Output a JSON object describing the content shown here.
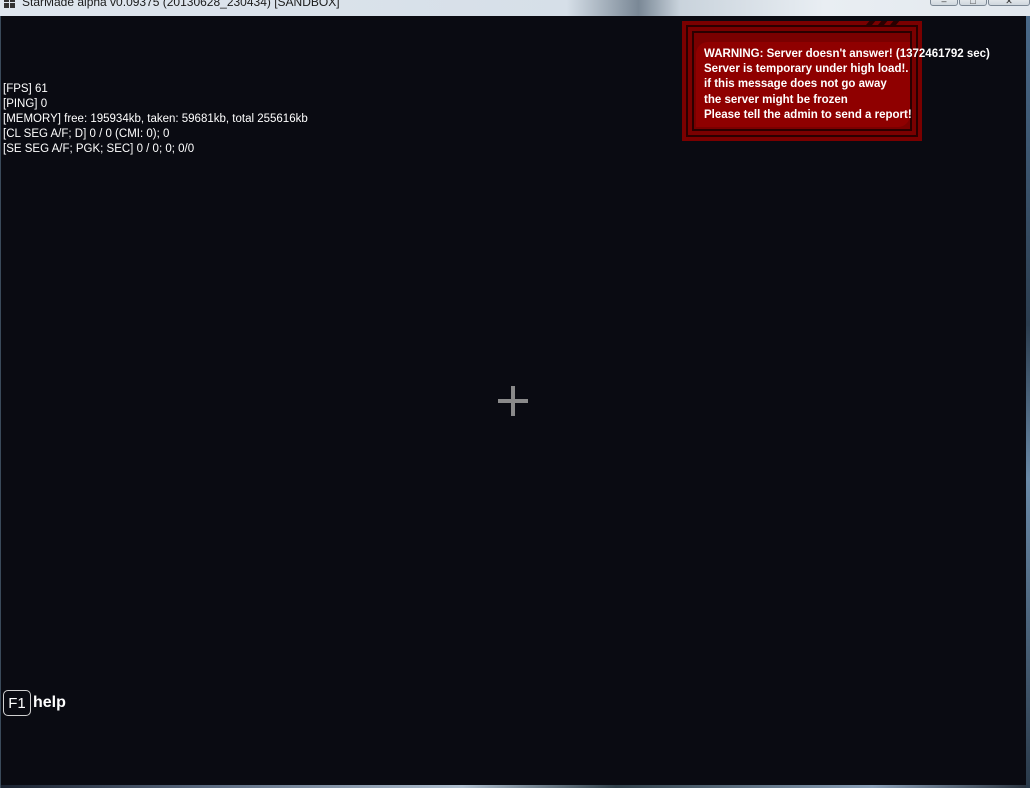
{
  "window": {
    "title": "StarMade alpha v0.09375 (20130628_230434) [SANDBOX]",
    "controls": {
      "minimize": "–",
      "maximize": "□",
      "close": "✕"
    }
  },
  "hud": {
    "lines": [
      "[FPS] 61",
      "[PING] 0",
      "[MEMORY] free: 195934kb, taken: 59681kb, total 255616kb",
      "[CL SEG A/F; D] 0 / 0 (CMI: 0); 0",
      "[SE SEG A/F; PGK; SEC] 0 / 0; 0; 0/0"
    ]
  },
  "warning": {
    "lines": [
      "WARNING: Server doesn't answer! (1372461792 sec)",
      "Server is temporary under high load!.",
      "if this message does not go away",
      "the server might be frozen",
      "Please tell the admin to send a report!"
    ]
  },
  "help": {
    "key": "F1",
    "label": "help"
  },
  "colors": {
    "background": "#0a0b12",
    "warning_panel": "#8f0000",
    "warning_border": "#7a0000",
    "text": "#ffffff",
    "crosshair": "#8a8a8a"
  },
  "icons": {
    "title_icon": "windows-logo-icon",
    "crosshair": "crosshair-icon"
  }
}
